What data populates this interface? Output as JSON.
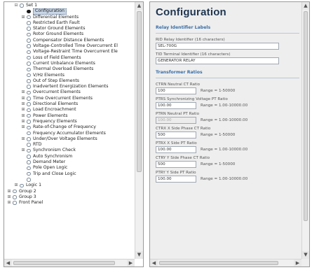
{
  "tree": {
    "items": [
      {
        "level": 1,
        "expander": "-",
        "node": "ring",
        "label": "Set 1"
      },
      {
        "level": 2,
        "expander": "",
        "node": "dot",
        "label": "Configuration",
        "selected": true
      },
      {
        "level": 2,
        "expander": "+",
        "node": "ring",
        "label": "Differential Elements"
      },
      {
        "level": 2,
        "expander": "",
        "node": "ring",
        "label": "Restricted Earth Fault"
      },
      {
        "level": 2,
        "expander": "",
        "node": "ring",
        "label": "Stator Ground Elements"
      },
      {
        "level": 2,
        "expander": "",
        "node": "ring",
        "label": "Rotor Ground Elements"
      },
      {
        "level": 2,
        "expander": "",
        "node": "ring",
        "label": "Compensator Distance Elements"
      },
      {
        "level": 2,
        "expander": "",
        "node": "ring",
        "label": "Voltage-Controlled Time Overcurrent El"
      },
      {
        "level": 2,
        "expander": "",
        "node": "ring",
        "label": "Voltage-Restraint Time Overcurrent Ele"
      },
      {
        "level": 2,
        "expander": "",
        "node": "ring",
        "label": "Loss of Field Elements"
      },
      {
        "level": 2,
        "expander": "",
        "node": "ring",
        "label": "Current Unbalance Elements"
      },
      {
        "level": 2,
        "expander": "",
        "node": "ring",
        "label": "Thermal Overload Elements"
      },
      {
        "level": 2,
        "expander": "",
        "node": "ring",
        "label": "V/Hz Elements"
      },
      {
        "level": 2,
        "expander": "",
        "node": "ring",
        "label": "Out of Step Elements"
      },
      {
        "level": 2,
        "expander": "",
        "node": "ring",
        "label": "Inadvertent Energization Elements"
      },
      {
        "level": 2,
        "expander": "+",
        "node": "ring",
        "label": "Overcurrent Elements"
      },
      {
        "level": 2,
        "expander": "+",
        "node": "ring",
        "label": "Time Overcurrent Elements"
      },
      {
        "level": 2,
        "expander": "+",
        "node": "ring",
        "label": "Directional Elements"
      },
      {
        "level": 2,
        "expander": "+",
        "node": "ring",
        "label": "Load Encroachment"
      },
      {
        "level": 2,
        "expander": "+",
        "node": "ring",
        "label": "Power Elements"
      },
      {
        "level": 2,
        "expander": "+",
        "node": "ring",
        "label": "Frequency Elements"
      },
      {
        "level": 2,
        "expander": "+",
        "node": "ring",
        "label": "Rate-of-Change of Frequency"
      },
      {
        "level": 2,
        "expander": "",
        "node": "ring",
        "label": "Frequency Accumulator Elements"
      },
      {
        "level": 2,
        "expander": "+",
        "node": "ring",
        "label": "Under/Over Voltage Elements"
      },
      {
        "level": 2,
        "expander": "",
        "node": "ring",
        "label": "RTD"
      },
      {
        "level": 2,
        "expander": "+",
        "node": "ring",
        "label": "Synchronism Check"
      },
      {
        "level": 2,
        "expander": "",
        "node": "ring",
        "label": "Auto Synchronism"
      },
      {
        "level": 2,
        "expander": "",
        "node": "ring",
        "label": "Demand Meter"
      },
      {
        "level": 2,
        "expander": "",
        "node": "ring",
        "label": "Pole Open Logic"
      },
      {
        "level": 2,
        "expander": "",
        "node": "ring",
        "label": "Trip and Close Logic"
      },
      {
        "level": 2,
        "expander": "",
        "node": "ring",
        "label": ""
      },
      {
        "level": 1,
        "expander": "+",
        "node": "ring",
        "label": "Logic 1"
      },
      {
        "level": 0,
        "expander": "+",
        "node": "ring",
        "label": "Group 2"
      },
      {
        "level": 0,
        "expander": "+",
        "node": "ring",
        "label": "Group 3"
      },
      {
        "level": 0,
        "expander": "+",
        "node": "ring",
        "label": "Front Panel"
      }
    ]
  },
  "settings": {
    "title": "Configuration",
    "relay_section": {
      "title": "Relay Identifier Labels",
      "fields": [
        {
          "label": "RID  Relay Identifier (16 characters)",
          "value": "SEL-700G",
          "width": "wide",
          "range": ""
        },
        {
          "label": "TID  Terminal Identifier (16 characters)",
          "value": "GENERATOR RELAY",
          "width": "wide",
          "range": ""
        }
      ]
    },
    "ratio_section": {
      "title": "Transformer Ratios",
      "fields": [
        {
          "label": "CTRN  Neutral CT Ratio",
          "value": "100",
          "width": "short",
          "range": "Range = 1-50000"
        },
        {
          "label": "PTRS  Synchronizing Voltage PT Ratio",
          "value": "100.00",
          "width": "short",
          "range": "Range = 1.00-10000.00"
        },
        {
          "label": "PTRN  Neutral PT Ratio",
          "value": "100.00",
          "width": "short",
          "range": "Range = 1.00-10000.00",
          "disabled": true
        },
        {
          "label": "CTRX  X Side Phase CT Ratio",
          "value": "500",
          "width": "short",
          "range": "Range = 1-50000"
        },
        {
          "label": "PTRX  X Side PT Ratio",
          "value": "100.00",
          "width": "short",
          "range": "Range = 1.00-10000.00"
        },
        {
          "label": "CTRY  Y Side Phase CT Ratio",
          "value": "500",
          "width": "short",
          "range": "Range = 1-50000"
        },
        {
          "label": "PTRY  Y Side PT Ratio",
          "value": "100.00",
          "width": "short",
          "range": "Range = 1.00-10000.00"
        }
      ]
    }
  },
  "icons": {
    "scroll_up": "scroll-up-arrow-icon",
    "scroll_down": "scroll-down-arrow-icon",
    "scroll_left": "scroll-left-arrow-icon",
    "scroll_right": "scroll-right-arrow-icon"
  },
  "colors": {
    "title": "#1e3550",
    "section_title": "#3a6fa8",
    "pane_background": "#eeeeee",
    "selection": "#c9d7e8"
  }
}
